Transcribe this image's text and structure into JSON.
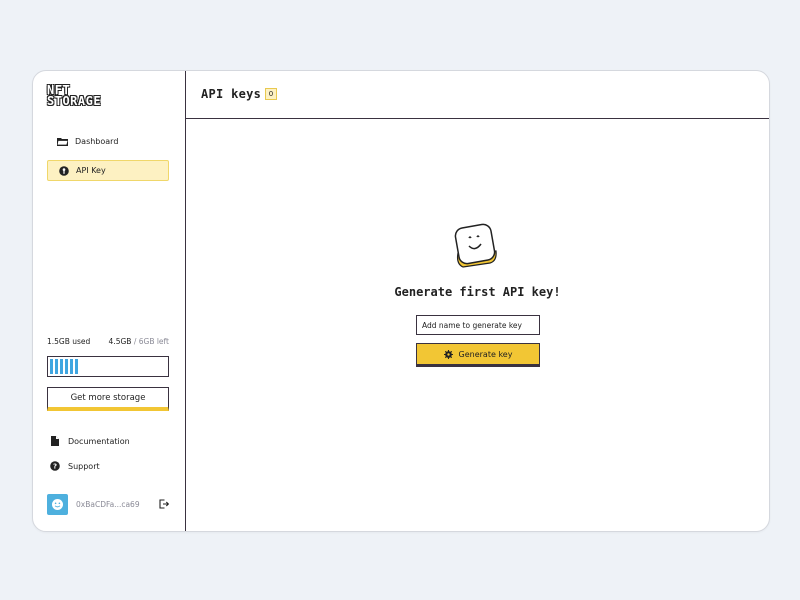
{
  "brand": {
    "logo_line1": "NFT",
    "logo_line2": "STORAGE"
  },
  "sidebar": {
    "items": [
      {
        "label": "Dashboard",
        "icon": "folder-icon",
        "active": false
      },
      {
        "label": "API Key",
        "icon": "key-icon",
        "active": true
      }
    ],
    "usage": {
      "used": "1.5GB used",
      "left_amount": "4.5GB",
      "left_total": "/ 6GB left",
      "used_fraction": 0.25
    },
    "more_storage_label": "Get more storage",
    "links": [
      {
        "label": "Documentation",
        "icon": "document-icon"
      },
      {
        "label": "Support",
        "icon": "help-icon"
      }
    ],
    "user": {
      "address": "0xBaCDFa...ca69"
    }
  },
  "header": {
    "title": "API keys",
    "count": "0"
  },
  "empty_state": {
    "title": "Generate first API key!",
    "input_placeholder": "Add name to generate key",
    "button_label": "Generate key"
  },
  "colors": {
    "accent_yellow": "#f2c634",
    "progress_blue": "#40a6e0",
    "active_bg": "#fdf1c2"
  }
}
